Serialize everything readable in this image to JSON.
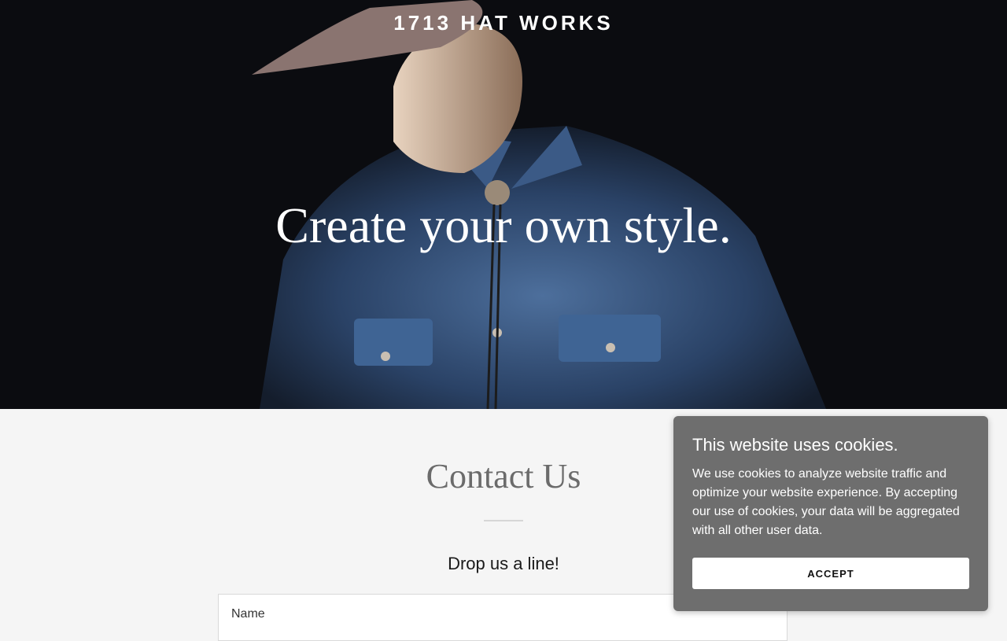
{
  "header": {
    "brand": "1713 HAT WORKS"
  },
  "hero": {
    "title": "Create your own style."
  },
  "contact": {
    "title": "Contact Us",
    "subtitle": "Drop us a line!",
    "name_label": "Name"
  },
  "cookie_banner": {
    "title": "This website uses cookies.",
    "body": "We use cookies to analyze website traffic and optimize your website experience. By accepting our use of cookies, your data will be aggregated with all other user data.",
    "accept_label": "ACCEPT"
  },
  "colors": {
    "hero_bg": "#0b0c10",
    "denim": "#2f4a70",
    "page_bg": "#f5f5f5",
    "cookie_bg": "#6e6e6e"
  }
}
